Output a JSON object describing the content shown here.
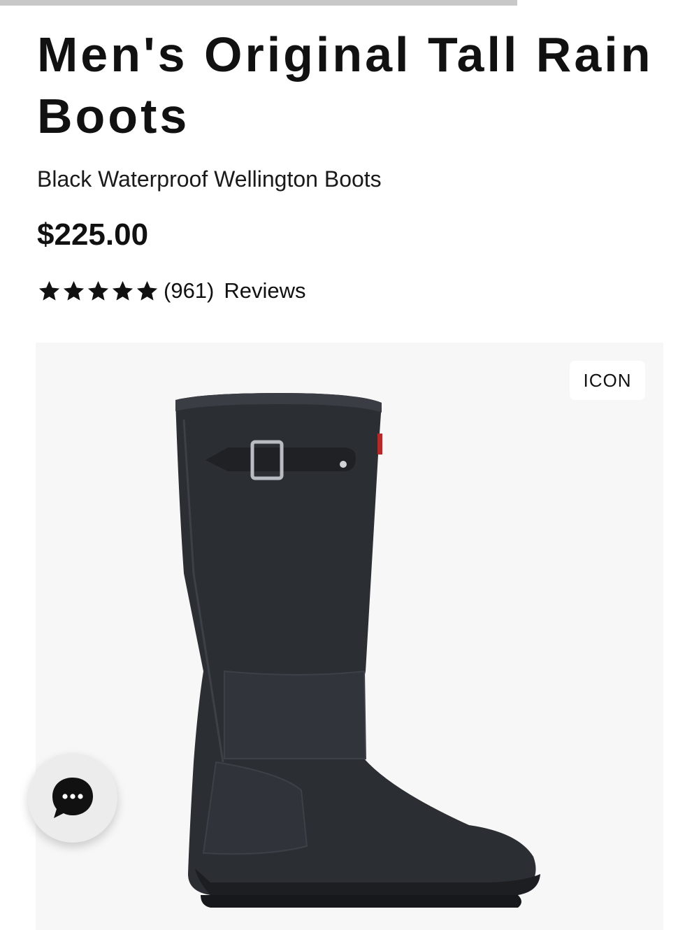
{
  "scroll_progress": 0.74,
  "product": {
    "title": "Men's Original Tall Rain Boots",
    "subtitle": "Black Waterproof Wellington Boots",
    "price": "$225.00",
    "rating": {
      "stars": 5,
      "max_stars": 5,
      "count_text": "(961)",
      "reviews_label": "Reviews"
    }
  },
  "gallery": {
    "badge": "ICON",
    "image_name": "black-tall-rain-boot"
  },
  "chat": {
    "icon": "chat-bubble-ellipsis-icon"
  },
  "colors": {
    "text": "#111111",
    "gallery_bg": "#f7f7f7",
    "boot": "#2b2e33",
    "progress": "#c8c8c8"
  }
}
